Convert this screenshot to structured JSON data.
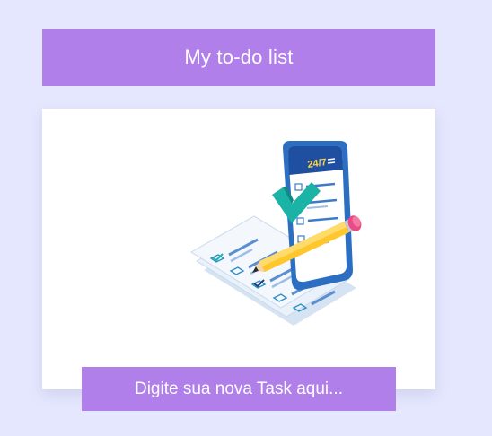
{
  "header": {
    "title": "My to-do list"
  },
  "illustration": {
    "icon": "checklist-phone-illustration",
    "badge_text": "24/7"
  },
  "task_input": {
    "placeholder": "Digite sua nova Task aqui...",
    "value": ""
  },
  "colors": {
    "background": "#e5e7fe",
    "accent": "#b07fea",
    "card": "#ffffff",
    "text_on_accent": "#ffffff"
  }
}
